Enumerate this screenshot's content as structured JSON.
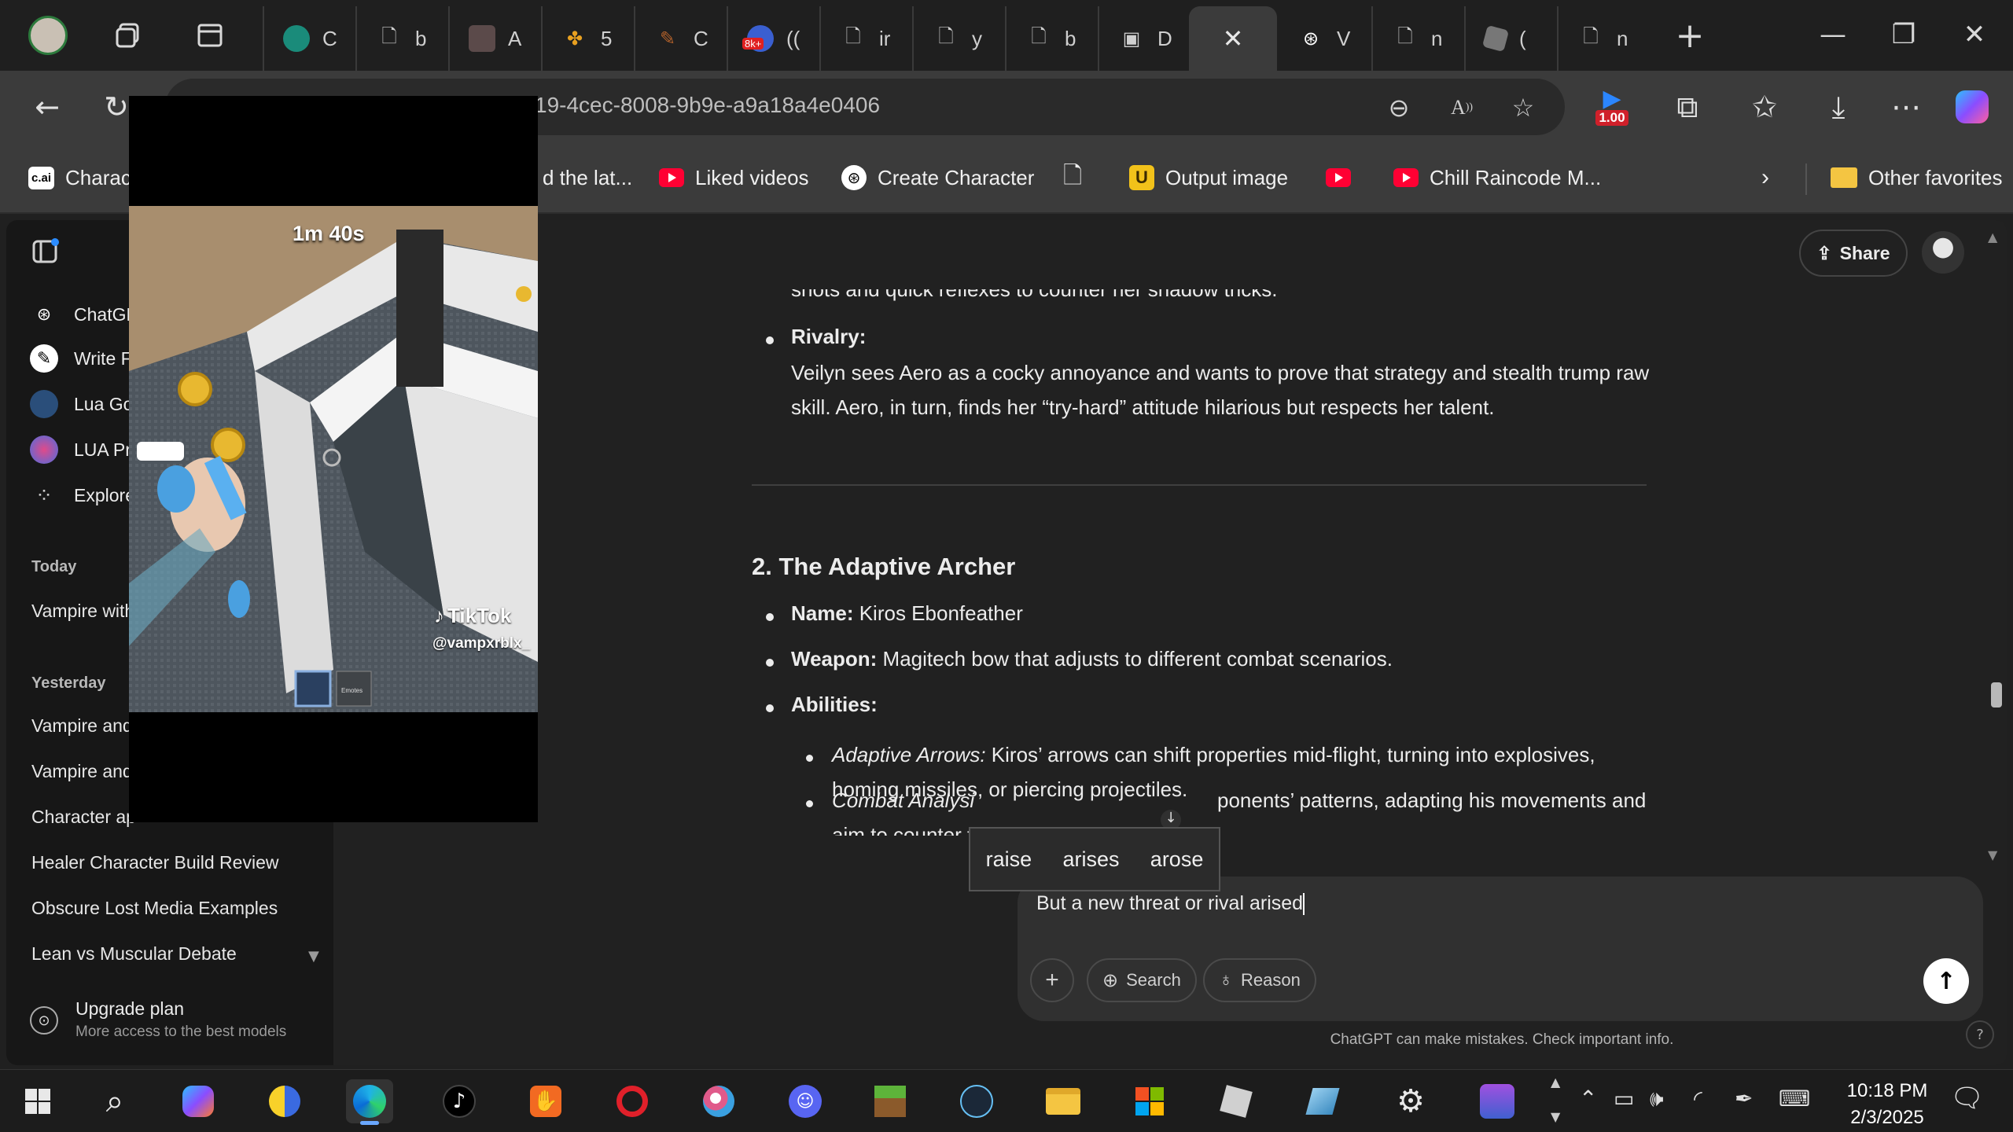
{
  "browser": {
    "tabs": [
      {
        "label": "C",
        "icon": "chatgpt-icon"
      },
      {
        "label": "b",
        "icon": "page-icon"
      },
      {
        "label": "A",
        "icon": "image-icon"
      },
      {
        "label": "5",
        "icon": "pinwheel-icon"
      },
      {
        "label": "C",
        "icon": "brush-icon"
      },
      {
        "label": "((",
        "icon": "badge-icon"
      },
      {
        "label": "ir",
        "icon": "page-icon"
      },
      {
        "label": "y",
        "icon": "page-icon"
      },
      {
        "label": "b",
        "icon": "page-icon"
      },
      {
        "label": "D",
        "icon": "picture-icon"
      },
      {
        "label": "V",
        "icon": "chatgpt-icon"
      },
      {
        "label": "n",
        "icon": "page-icon"
      },
      {
        "label": "(",
        "icon": "roblox-icon"
      },
      {
        "label": "n",
        "icon": "page-icon"
      }
    ],
    "badge_8k": "8k+",
    "url": "19-4cec-8008-9b9e-a9a18a4e0406",
    "ext_badge": "1.00",
    "favorites": [
      {
        "label": "Charact",
        "icon": "cai-icon"
      },
      {
        "label": "d the lat..."
      },
      {
        "label": "Liked videos",
        "icon": "youtube-icon"
      },
      {
        "label": "Create Character",
        "icon": "openai-icon"
      },
      {
        "label": "",
        "icon": "page-icon"
      },
      {
        "label": "Output image",
        "icon": "u-icon"
      },
      {
        "label": "",
        "icon": "youtube-icon"
      },
      {
        "label": "Chill Raincode M...",
        "icon": "youtube-icon"
      },
      {
        "label": "Other favorites",
        "icon": "folder-icon"
      }
    ],
    "cai_logo": "c.ai"
  },
  "sidebar": {
    "items": [
      {
        "label": "ChatGP"
      },
      {
        "label": "Write F"
      },
      {
        "label": "Lua Go"
      },
      {
        "label": "LUA Pr"
      },
      {
        "label": "Explore"
      }
    ],
    "sections": [
      {
        "title": "Today",
        "chats": [
          "Vampire with"
        ]
      },
      {
        "title": "Yesterday",
        "chats": [
          "Vampire and",
          "Vampire and",
          "Character ap",
          "Healer Character Build Review",
          "Obscure Lost Media Examples",
          "Lean vs Muscular Debate"
        ]
      }
    ],
    "upgrade": {
      "title": "Upgrade plan",
      "subtitle": "More access to the best models"
    }
  },
  "header": {
    "share": "Share"
  },
  "content": {
    "partial_line": "shots and quick reflexes to counter her shadow tricks.",
    "rivalry_label": "Rivalry:",
    "rivalry_line1": "Veilyn sees Aero as a cocky annoyance and wants to prove that strategy and stealth trump raw",
    "rivalry_line2": "skill. Aero, in turn, finds her “try-hard” attitude hilarious but respects her talent.",
    "section_title": "2. The Adaptive Archer",
    "name_label": "Name:",
    "name_value": "Kiros Ebonfeather",
    "weapon_label": "Weapon:",
    "weapon_value": "Magitech bow that adjusts to different combat scenarios.",
    "abilities_label": "Abilities:",
    "arrows_label": "Adaptive Arrows:",
    "arrows_line1": "Kiros’ arrows can shift properties mid-flight, turning into explosives,",
    "arrows_line2": "homing missiles, or piercing projectiles.",
    "combat_label": "Combat Analysi",
    "combat_line1_end": "ponents’ patterns, adapting his movements and",
    "combat_line2": "aim to counter t"
  },
  "composer": {
    "text": "But a new threat or rival arised",
    "plus": "+",
    "search": "Search",
    "reason": "Reason",
    "disclaimer": "ChatGPT can make mistakes. Check important info.",
    "help": "?"
  },
  "suggestions": [
    "raise",
    "arises",
    "arose"
  ],
  "video": {
    "timer": "1m 40s",
    "brand": "TikTok",
    "handle": "@vampxrblx_",
    "emotes": "Emotes"
  },
  "taskbar": {
    "time": "10:18 PM",
    "date": "2/3/2025"
  }
}
